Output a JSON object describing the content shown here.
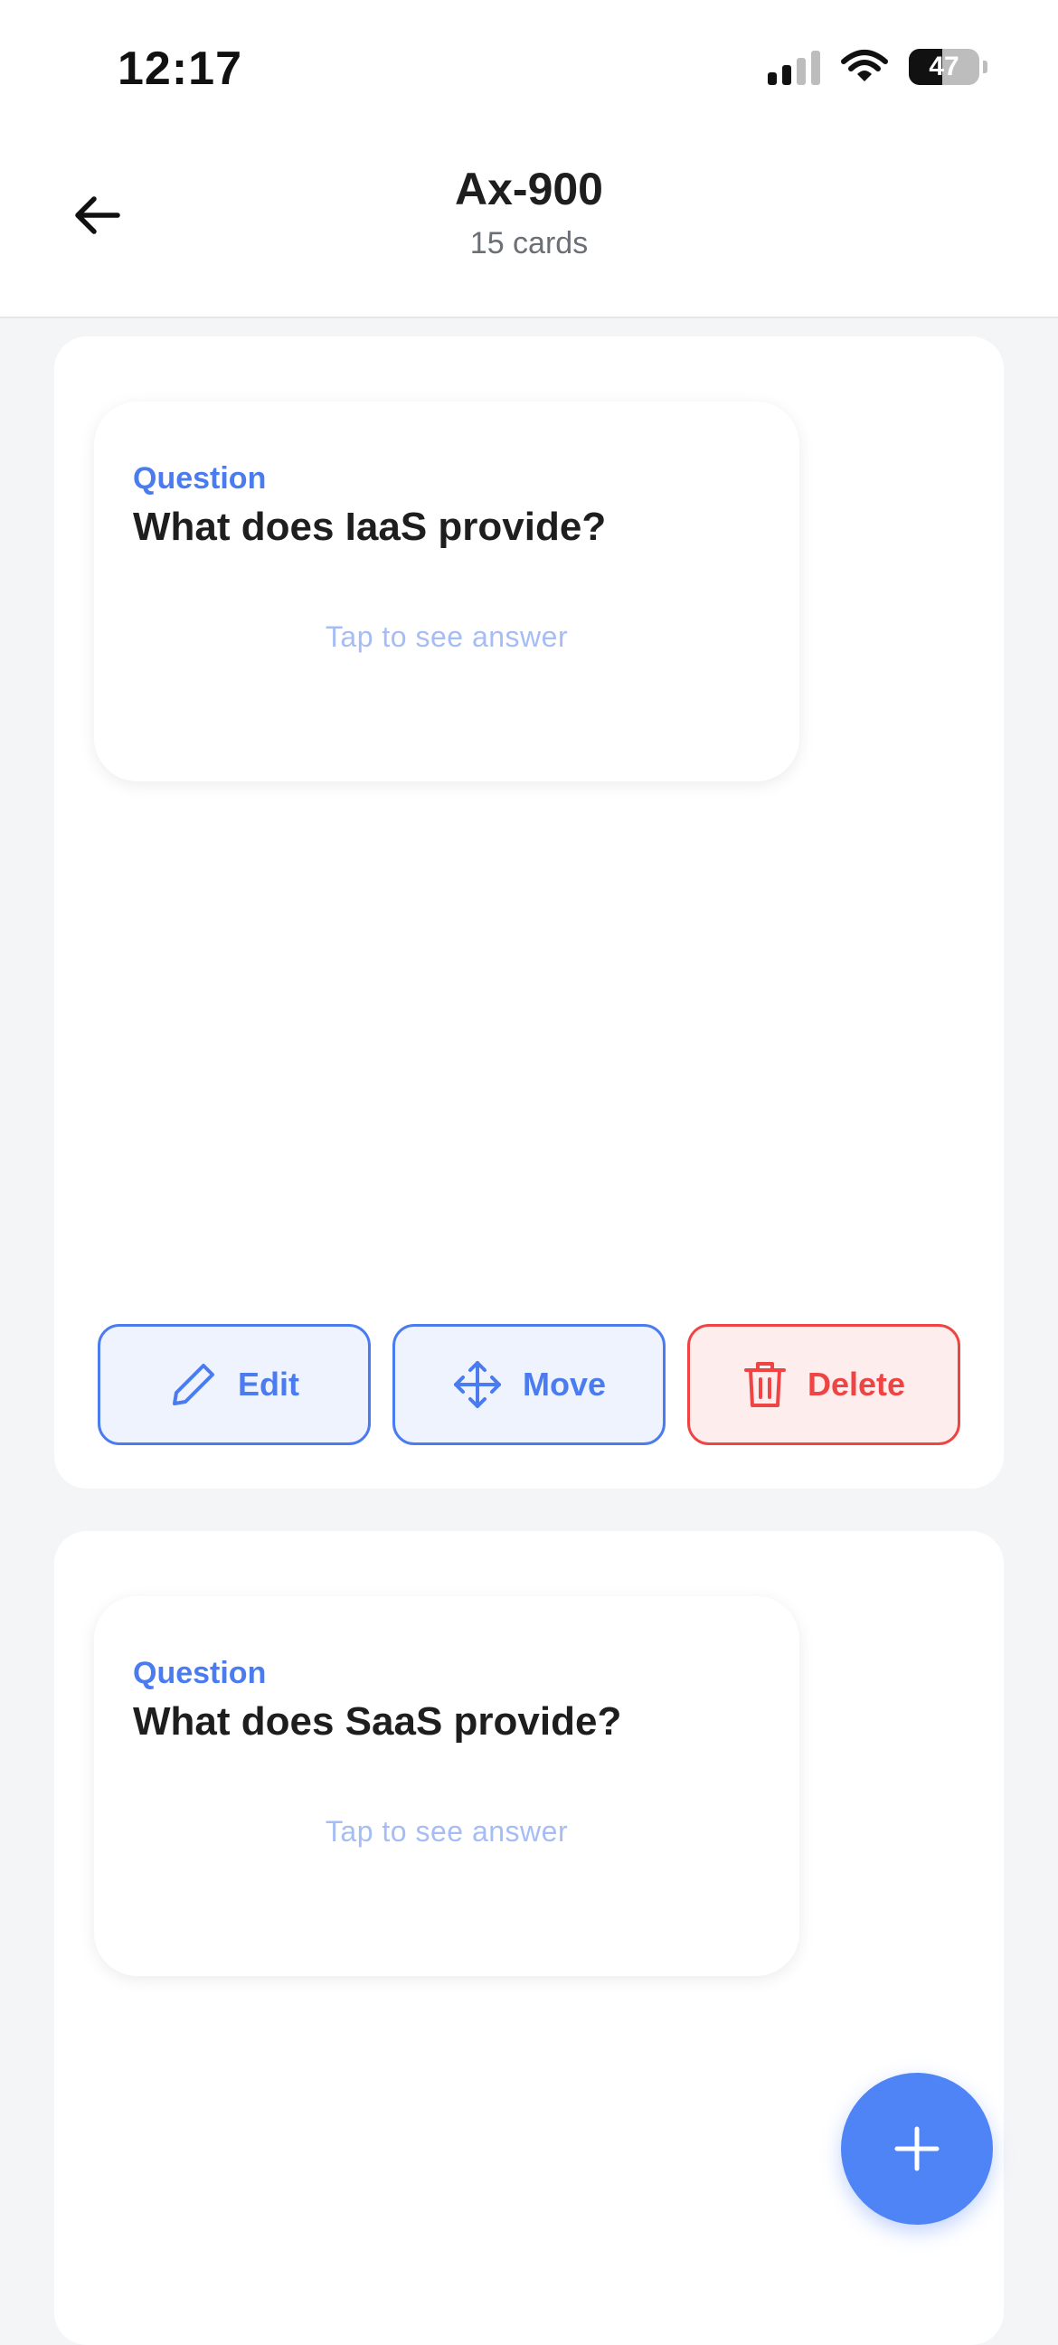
{
  "status_bar": {
    "time": "12:17",
    "battery_percent": "47",
    "battery_level": 0.47,
    "signal_bars_active": 2,
    "signal_bars_total": 4
  },
  "header": {
    "title": "Ax-900",
    "subtitle": "15 cards",
    "back_icon": "arrow-left-icon"
  },
  "cards": [
    {
      "label": "Question",
      "question": "What does IaaS provide?",
      "hint": "Tap to see answer"
    },
    {
      "label": "Question",
      "question": "What does SaaS provide?",
      "hint": "Tap to see answer"
    }
  ],
  "actions": {
    "edit": {
      "label": "Edit",
      "icon": "pencil-icon"
    },
    "move": {
      "label": "Move",
      "icon": "move-arrows-icon"
    },
    "delete": {
      "label": "Delete",
      "icon": "trash-icon"
    }
  },
  "fab": {
    "icon": "plus-icon"
  },
  "colors": {
    "accent": "#4A7CF0",
    "danger": "#EF4444",
    "hint": "#A6BCF4",
    "background": "#F4F5F7"
  }
}
